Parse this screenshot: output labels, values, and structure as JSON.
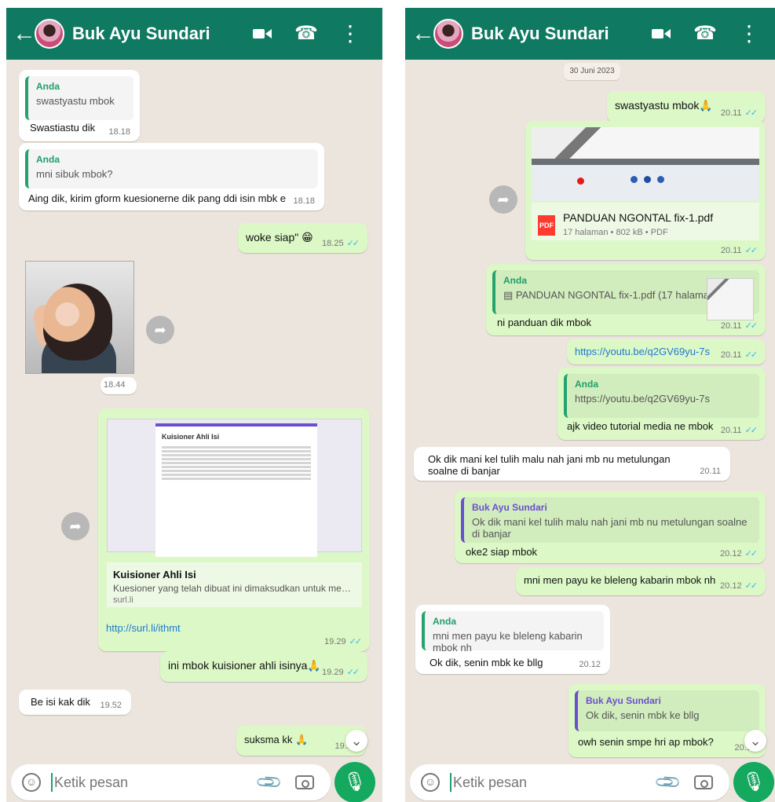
{
  "left": {
    "header": {
      "title": "Buk Ayu Sundari"
    },
    "messages": [
      {
        "quote_author": "Anda",
        "quote_text": "swastyastu mbok",
        "text": "Swastiastu dik",
        "time": "18.18"
      },
      {
        "quote_author": "Anda",
        "quote_text": "mni sibuk mbok?",
        "text": "Aing dik, kirim gform kuesionerne dik pang ddi isin mbk e",
        "time": "18.18"
      },
      {
        "text": "woke siap\" 😁",
        "time": "18.25",
        "status": "✓✓"
      },
      {
        "photo_time": "18.44"
      },
      {
        "doc_title": "Kuisioner Ahli Isi",
        "link_title": "Kuisioner Ahli Isi",
        "link_description": "Kuesioner yang telah dibuat ini dimaksudkan untuk mengetahui...",
        "link_domain": "surl.li",
        "url": "http://surl.li/ithmt",
        "time": "19.29",
        "status": "✓✓"
      },
      {
        "text": "ini mbok kuisioner ahli isinya🙏",
        "time": "19.29",
        "status": "✓✓"
      },
      {
        "text": "Be isi kak dik",
        "time": "19.52"
      },
      {
        "text": "suksma kk 🙏",
        "time": "19.55"
      }
    ],
    "input": {
      "placeholder": "Ketik pesan"
    }
  },
  "right": {
    "header": {
      "title": "Buk Ayu Sundari"
    },
    "date_chip": "30 Juni 2023",
    "messages": [
      {
        "text": "swastyastu mbok🙏",
        "time": "20.11",
        "status": "✓✓"
      },
      {
        "pdf_title": "PANDUAN NGONTAL fix-1.pdf",
        "pdf_meta": "17 halaman • 802 kB • PDF",
        "time": "20.11",
        "status": "✓✓"
      },
      {
        "quote_author": "Anda",
        "quote_text": "▤ PANDUAN NGONTAL fix-1.pdf (17 halaman)",
        "text": "ni panduan dik mbok",
        "time": "20.11",
        "status": "✓✓"
      },
      {
        "text": "https://youtu.be/q2GV69yu-7s",
        "time": "20.11",
        "status": "✓✓"
      },
      {
        "quote_author": "Anda",
        "quote_text": "https://youtu.be/q2GV69yu-7s",
        "text": "ajk video tutorial media ne mbok",
        "time": "20.11",
        "status": "✓✓"
      },
      {
        "text": "Ok dik mani kel tulih malu nah jani mb nu metulungan soalne di banjar",
        "time": "20.11"
      },
      {
        "quote_author": "Buk Ayu Sundari",
        "quote_text": "Ok dik mani kel tulih malu nah jani mb nu metulungan soalne di banjar",
        "text": "oke2 siap mbok",
        "time": "20.12",
        "status": "✓✓"
      },
      {
        "text": "mni men payu ke bleleng kabarin mbok nh",
        "time": "20.12",
        "status": "✓✓"
      },
      {
        "quote_author": "Anda",
        "quote_text": "mni men payu ke bleleng kabarin mbok nh",
        "text": "Ok dik, senin mbk ke bllg",
        "time": "20.12"
      },
      {
        "quote_author": "Buk Ayu Sundari",
        "quote_text": "Ok dik, senin mbk ke bllg",
        "text": "owh senin smpe hri ap mbok?",
        "time": "20.12"
      }
    ],
    "input": {
      "placeholder": "Ketik pesan"
    }
  }
}
